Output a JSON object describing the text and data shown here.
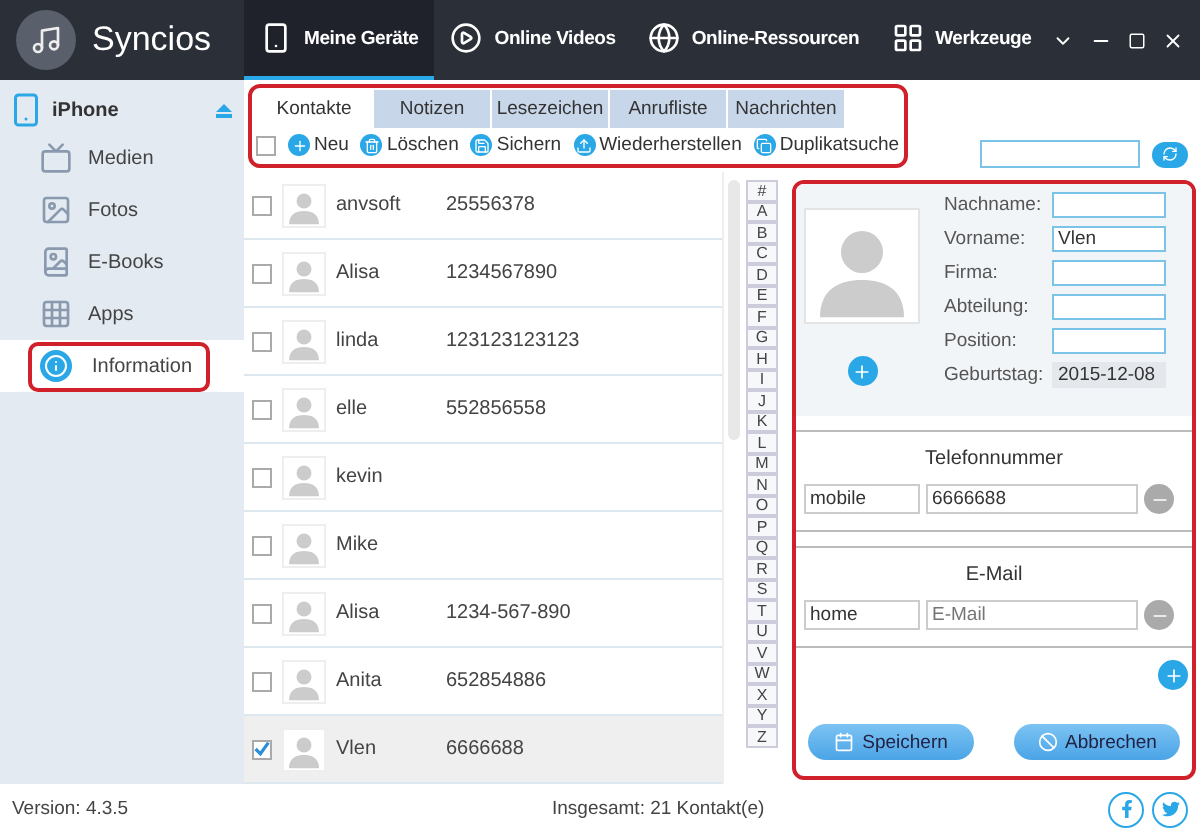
{
  "window": {
    "title": "Syncios"
  },
  "nav": [
    {
      "label": "Meine Geräte",
      "selected": true
    },
    {
      "label": "Online Videos",
      "selected": false
    },
    {
      "label": "Online-Ressourcen",
      "selected": false
    },
    {
      "label": "Werkzeuge",
      "selected": false
    }
  ],
  "sidebar": {
    "device": "iPhone",
    "items": [
      {
        "label": "Medien",
        "selected": false
      },
      {
        "label": "Fotos",
        "selected": false
      },
      {
        "label": "E-Books",
        "selected": false
      },
      {
        "label": "Apps",
        "selected": false
      },
      {
        "label": "Information",
        "selected": true
      }
    ]
  },
  "tabs": [
    {
      "label": "Kontakte",
      "selected": true
    },
    {
      "label": "Notizen",
      "selected": false
    },
    {
      "label": "Lesezeichen",
      "selected": false
    },
    {
      "label": "Anrufliste",
      "selected": false
    },
    {
      "label": "Nachrichten",
      "selected": false
    }
  ],
  "toolbar": {
    "select_all": false,
    "actions": [
      {
        "label": "Neu"
      },
      {
        "label": "Löschen"
      },
      {
        "label": "Sichern"
      },
      {
        "label": "Wiederherstellen"
      },
      {
        "label": "Duplikatsuche"
      }
    ]
  },
  "contacts": [
    {
      "name": "anvsoft",
      "phone": "25556378",
      "checked": false,
      "selected": false
    },
    {
      "name": "Alisa",
      "phone": "1234567890",
      "checked": false,
      "selected": false
    },
    {
      "name": "linda",
      "phone": "123123123123",
      "checked": false,
      "selected": false
    },
    {
      "name": "elle",
      "phone": "552856558",
      "checked": false,
      "selected": false
    },
    {
      "name": "kevin",
      "checked": false,
      "selected": false
    },
    {
      "name": "Mike",
      "checked": false,
      "selected": false
    },
    {
      "name": "Alisa",
      "phone": "1234-567-890",
      "checked": false,
      "selected": false
    },
    {
      "name": "Anita",
      "phone": "652854886",
      "checked": false,
      "selected": false
    },
    {
      "name": "Vlen",
      "phone": "6666688",
      "checked": true,
      "selected": true
    }
  ],
  "alphabet": [
    "#",
    "A",
    "B",
    "C",
    "D",
    "E",
    "F",
    "G",
    "H",
    "I",
    "J",
    "K",
    "L",
    "M",
    "N",
    "O",
    "P",
    "Q",
    "R",
    "S",
    "T",
    "U",
    "V",
    "W",
    "X",
    "Y",
    "Z"
  ],
  "detail": {
    "fields": [
      {
        "label": "Nachname:",
        "readonly": false
      },
      {
        "label": "Vorname:",
        "value": "Vlen",
        "readonly": false
      },
      {
        "label": "Firma:",
        "readonly": false
      },
      {
        "label": "Abteilung:",
        "readonly": false
      },
      {
        "label": "Position:",
        "readonly": false
      },
      {
        "label": "Geburtstag:",
        "value": "2015-12-08",
        "readonly": true
      }
    ],
    "sections": [
      {
        "title": "Telefonnummer",
        "type": "mobile",
        "value": "6666688"
      },
      {
        "title": "E-Mail",
        "type": "home",
        "placeholder": "E-Mail"
      }
    ],
    "buttons": [
      {
        "label": "Speichern"
      },
      {
        "label": "Abbrechen"
      }
    ]
  },
  "status_bar": {
    "version": "Version: 4.3.5",
    "total": "Insgesamt: 21 Kontakt(e)"
  }
}
